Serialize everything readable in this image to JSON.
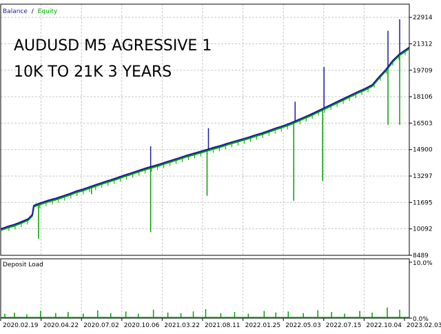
{
  "legend": {
    "balance": "Balance",
    "separator": "/",
    "equity": "Equity"
  },
  "annotation": {
    "line1": "AUDUSD M5 AGRESSIVE 1",
    "line2": "10K TO 21K 3 YEARS"
  },
  "subchart_title": "Deposit Load",
  "colors": {
    "balance": "#1a1aa0",
    "equity": "#00a000",
    "grid": "#c8c8c8",
    "axis": "#000000",
    "text": "#000000"
  },
  "chart_data": [
    {
      "type": "line",
      "name": "balance-equity",
      "ylim": [
        8489,
        23716
      ],
      "grid": true,
      "yticks": [
        8489,
        10092,
        11695,
        13297,
        14900,
        16503,
        18106,
        19709,
        21312,
        22914
      ],
      "xtick_labels": [
        "2020.02.19",
        "2020.04.22",
        "2020.07.02",
        "2020.10.06",
        "2021.03.22",
        "2021.08.11",
        "2022.01.25",
        "2022.05.03",
        "2022.07.15",
        "2022.10.04",
        "2023.02.03"
      ],
      "x": [
        0,
        5,
        10,
        20,
        30,
        40,
        46,
        48,
        52,
        55,
        60,
        70,
        80,
        90,
        100,
        110,
        120,
        130,
        140,
        150,
        160,
        170,
        180,
        190,
        200,
        210,
        220,
        230,
        240,
        250,
        260,
        270,
        280,
        290,
        300,
        310,
        320,
        330,
        340,
        350,
        360,
        370,
        380,
        390,
        400,
        410,
        420,
        430,
        440,
        450,
        460,
        470,
        480,
        490,
        500,
        510,
        520,
        530,
        540,
        550,
        560,
        570,
        580,
        594
      ],
      "series": [
        {
          "name": "Balance",
          "values": [
            10092,
            10160,
            10240,
            10360,
            10520,
            10700,
            10960,
            11500,
            11580,
            11620,
            11690,
            11830,
            11940,
            12080,
            12220,
            12380,
            12500,
            12650,
            12790,
            12930,
            13060,
            13200,
            13350,
            13480,
            13620,
            13760,
            13880,
            14000,
            14140,
            14270,
            14400,
            14540,
            14660,
            14780,
            14900,
            15030,
            15140,
            15280,
            15400,
            15520,
            15640,
            15780,
            15900,
            16050,
            16200,
            16330,
            16480,
            16660,
            16840,
            17020,
            17220,
            17420,
            17620,
            17820,
            18020,
            18220,
            18420,
            18600,
            18820,
            19300,
            19750,
            20300,
            20700,
            21100
          ]
        }
      ],
      "equity_drawdowns": [
        {
          "x": 55,
          "low": 9500
        },
        {
          "x": 132,
          "low": 12200
        },
        {
          "x": 218,
          "low": 9900
        },
        {
          "x": 300,
          "low": 12100
        },
        {
          "x": 426,
          "low": 11800
        },
        {
          "x": 468,
          "low": 13000
        },
        {
          "x": 563,
          "low": 16400
        },
        {
          "x": 580,
          "low": 16400
        }
      ],
      "balance_spikes": [
        {
          "x": 218,
          "high": 15100
        },
        {
          "x": 302,
          "high": 16200
        },
        {
          "x": 428,
          "high": 17800
        },
        {
          "x": 470,
          "high": 19900
        },
        {
          "x": 563,
          "high": 22100
        },
        {
          "x": 580,
          "high": 22800
        }
      ]
    },
    {
      "type": "bar",
      "name": "deposit-load",
      "title": "Deposit Load",
      "ylim": [
        0,
        10
      ],
      "ytick_labels": [
        "10.0%",
        "0.0%"
      ],
      "x": [
        6,
        20,
        38,
        58,
        80,
        98,
        120,
        141,
        160,
        182,
        200,
        222,
        243,
        262,
        280,
        298,
        320,
        340,
        360,
        383,
        400,
        418,
        440,
        461,
        481,
        500,
        522,
        540,
        562,
        580
      ],
      "values": [
        0.8,
        1.0,
        0.7,
        1.3,
        0.9,
        1.1,
        0.8,
        1.4,
        0.9,
        1.2,
        0.8,
        1.5,
        1.0,
        0.9,
        1.2,
        1.6,
        0.9,
        1.1,
        0.8,
        1.3,
        1.0,
        1.2,
        0.9,
        1.4,
        1.1,
        0.8,
        1.3,
        1.0,
        1.9,
        1.5
      ]
    }
  ]
}
